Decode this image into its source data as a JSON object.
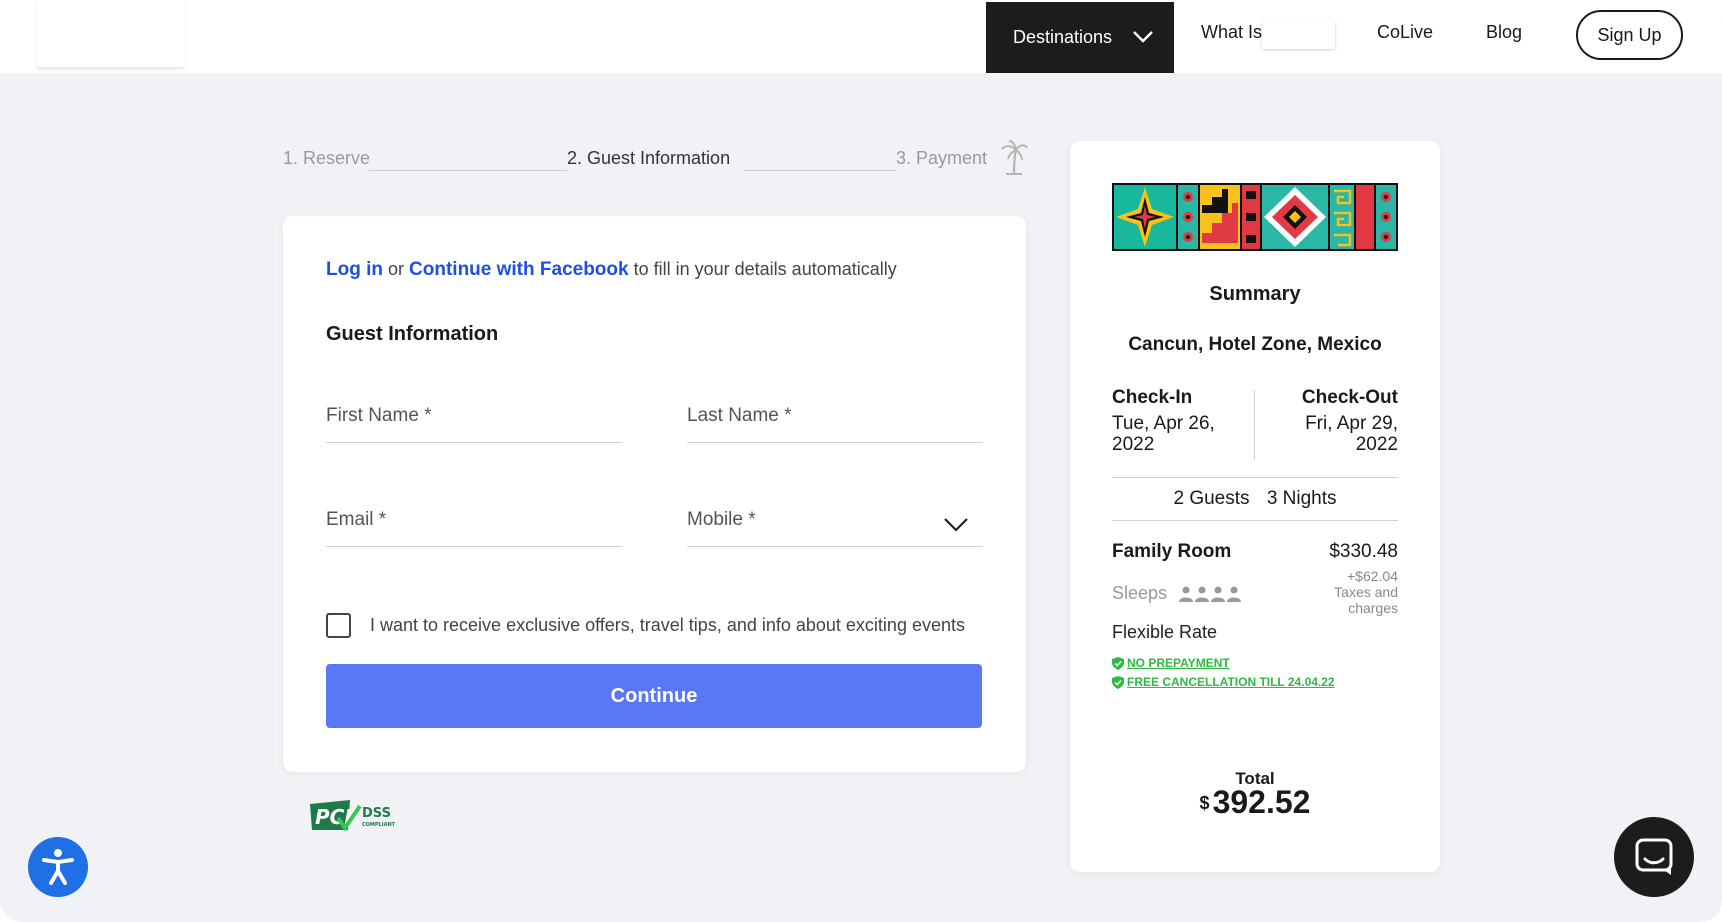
{
  "header": {
    "nav": {
      "destinations": "Destinations",
      "what_is": "What Is",
      "colive": "CoLive",
      "blog": "Blog",
      "sign_up": "Sign Up"
    }
  },
  "steps": [
    {
      "label": "1. Reserve",
      "state": "done"
    },
    {
      "label": "2. Guest Information",
      "state": "active"
    },
    {
      "label": "3. Payment",
      "state": "upcoming"
    }
  ],
  "form": {
    "login_link": "Log in",
    "or_text": "or",
    "facebook_link": "Continue with Facebook",
    "autofill_text": "to fill in your details automatically",
    "section_title": "Guest Information",
    "fields": {
      "first_name": "First Name *",
      "last_name": "Last Name *",
      "email": "Email *",
      "mobile": "Mobile *"
    },
    "offers_checkbox": {
      "label": "I want to receive exclusive offers, travel tips, and info about exciting events",
      "checked": false
    },
    "continue_button": "Continue"
  },
  "pci_badge": {
    "text": "PCI DSS COMPLIANT",
    "color": "#1f7a4a"
  },
  "summary": {
    "title": "Summary",
    "location": "Cancun, Hotel Zone, Mexico",
    "check_in_label": "Check-In",
    "check_in_date": "Tue, Apr 26, 2022",
    "check_out_label": "Check-Out",
    "check_out_date": "Fri, Apr 29, 2022",
    "guests": "2 Guests",
    "nights": "3 Nights",
    "room_name": "Family Room",
    "room_price": "$330.48",
    "tax_amount": "+$62.04",
    "tax_label": "Taxes and charges",
    "sleeps_label": "Sleeps",
    "sleeps_count": 4,
    "rate_name": "Flexible Rate",
    "perks": [
      "NO PREPAYMENT",
      "FREE CANCELLATION TILL 24.04.22"
    ],
    "total_label": "Total",
    "total_currency": "$",
    "total_amount": "392.52"
  },
  "colors": {
    "accent_button": "#5a78f5",
    "link": "#1f4fe0",
    "perk_green": "#2ebb41",
    "nav_dark": "#1c1c1c",
    "accessibility_blue": "#1f6fe5",
    "background": "#f1f2f5"
  },
  "icons": {
    "destinations_chevron": "chevron-down-icon",
    "mobile_chevron": "chevron-down-icon",
    "palm": "palm-tree-icon",
    "accessibility": "accessibility-icon",
    "chat": "chat-icon",
    "shield_check": "shield-check-icon",
    "person": "person-icon"
  }
}
